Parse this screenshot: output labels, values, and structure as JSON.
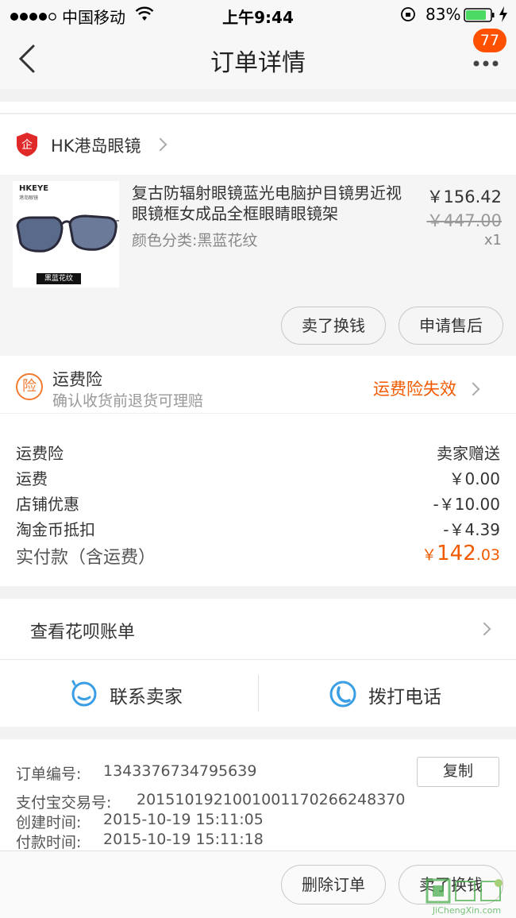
{
  "status_bar": {
    "carrier": "中国移动",
    "time": "上午9:44",
    "battery": "83%"
  },
  "nav": {
    "title": "订单详情",
    "badge_count": "77"
  },
  "shop": {
    "name": "HK港岛眼镜"
  },
  "product": {
    "brand_label": "HKEYE",
    "brand_sub": "港岛眼镜",
    "image_caption": "黑蓝花纹",
    "title": "复古防辐射眼镜蓝光电脑护目镜男近视眼镜框女成品全框眼睛眼镜架",
    "spec": "颜色分类:黑蓝花纹",
    "price": "￥156.42",
    "original_price": "￥447.00",
    "quantity": "x1"
  },
  "item_actions": {
    "sell_label": "卖了换钱",
    "after_sale_label": "申请售后"
  },
  "insurance": {
    "icon_char": "险",
    "title": "运费险",
    "desc": "确认收货前退货可理赔",
    "status": "运费险失效"
  },
  "summary": {
    "rows": [
      {
        "label": "运费险",
        "value": "卖家赠送"
      },
      {
        "label": "运费",
        "value": "￥0.00"
      },
      {
        "label": "店铺优惠",
        "value": "-￥10.00"
      },
      {
        "label": "淘金币抵扣",
        "value": "-￥4.39"
      }
    ],
    "total_label": "实付款（含运费）",
    "total_currency": "￥",
    "total_int": "142",
    "total_dec": ".03"
  },
  "huabei": {
    "label": "查看花呗账单"
  },
  "contact": {
    "seller_label": "联系卖家",
    "phone_label": "拨打电话"
  },
  "order_info": {
    "order_no_label": "订单编号:",
    "order_no": "1343376734795639",
    "copy_label": "复制",
    "alipay_label": "支付宝交易号:",
    "alipay_no": "2015101921001001170266248370",
    "created_label": "创建时间:",
    "created": "2015-10-19 15:11:05",
    "paid_label": "付款时间:",
    "paid": "2015-10-19 15:11:18"
  },
  "bottom_bar": {
    "delete_label": "删除订单",
    "sell_label": "卖了换钱"
  },
  "watermark": {
    "text": "JiChengXin.com"
  },
  "colors": {
    "accent": "#ff5000",
    "link_blue": "#3a9ee4",
    "background": "#f2f2f2"
  }
}
